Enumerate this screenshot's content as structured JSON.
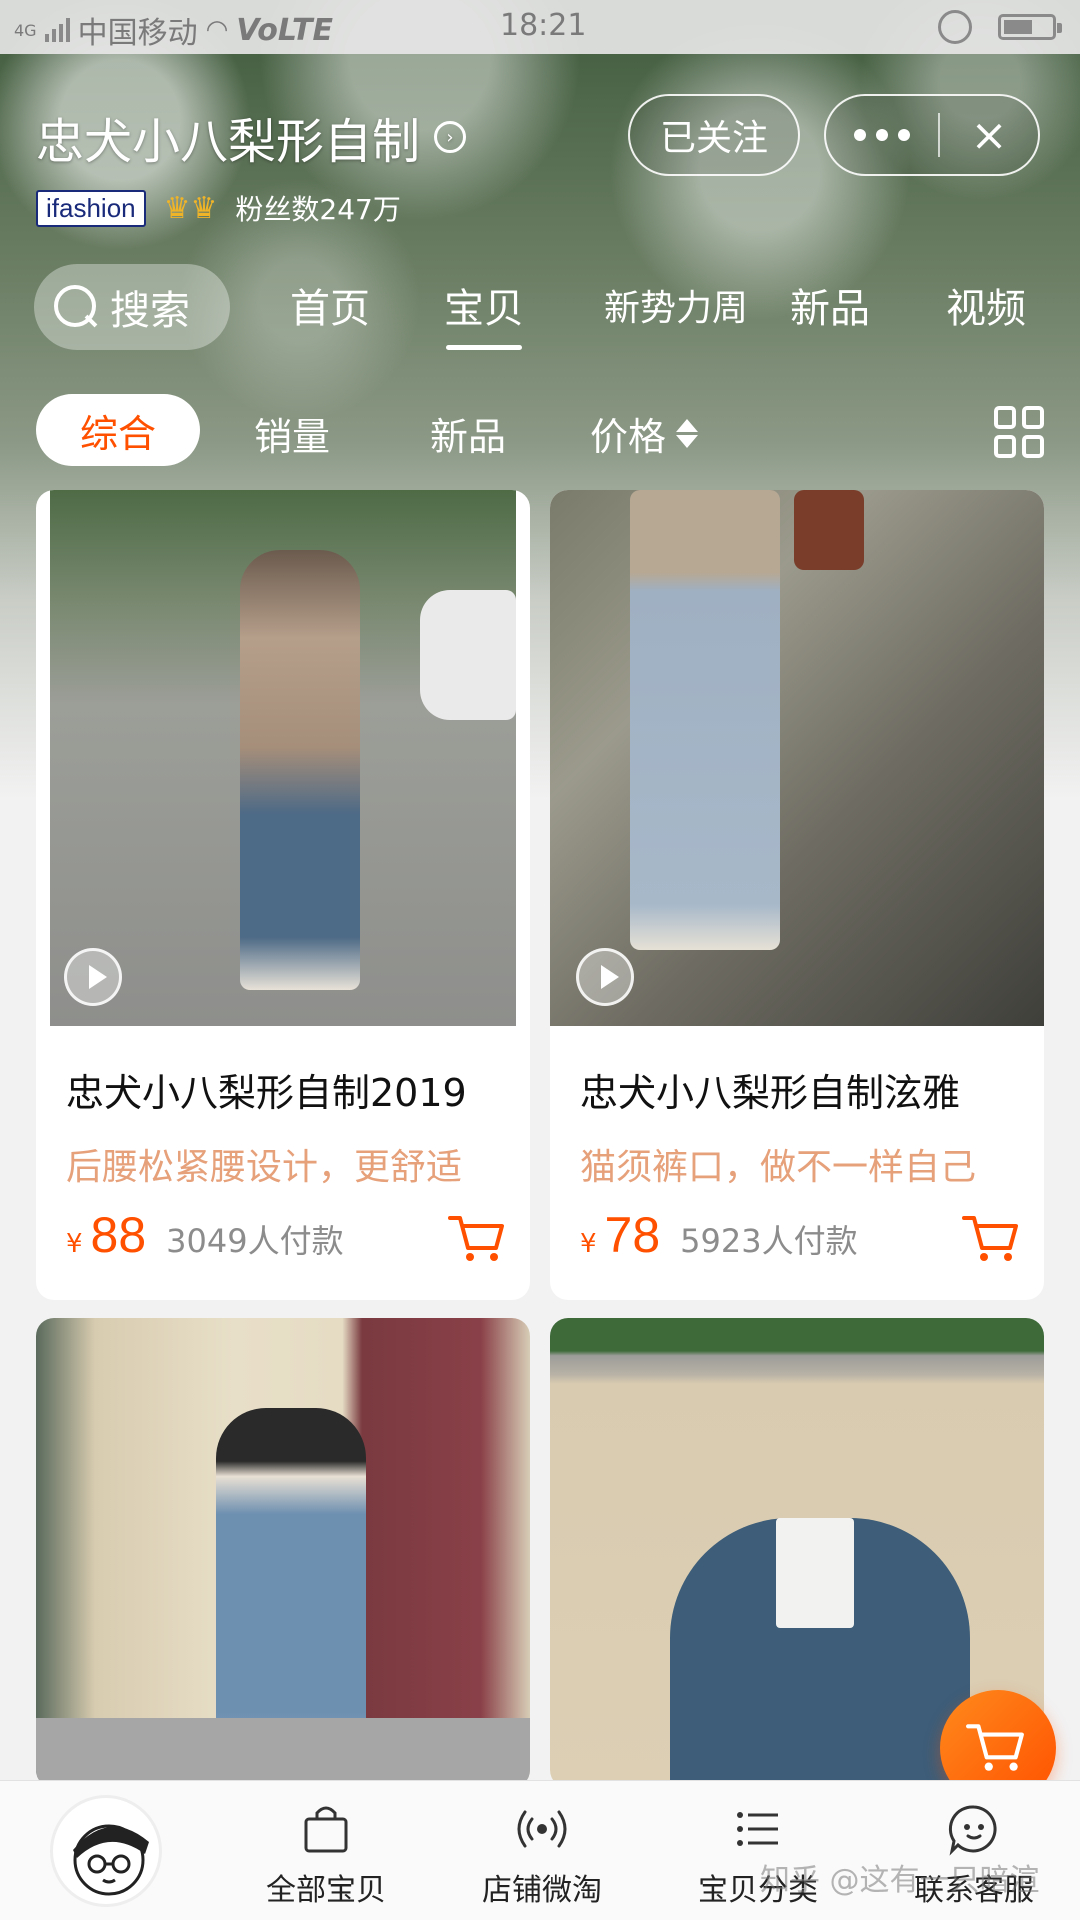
{
  "status_bar": {
    "carrier": "中国移动",
    "network": "4G",
    "volte": "VoLTE",
    "time": "18:21",
    "battery_level": 0.6
  },
  "header": {
    "shop_name": "忠犬小八梨形自制",
    "follow_button": "已关注",
    "badge": "ifashion",
    "fans": "粉丝数247万",
    "icons": [
      "chevron-right-circle-icon",
      "more-icon",
      "close-icon",
      "crown-icon"
    ]
  },
  "search": {
    "label": "搜索"
  },
  "tabs": [
    {
      "label": "首页",
      "active": false
    },
    {
      "label": "宝贝",
      "active": true
    },
    {
      "label": "新势力周",
      "active": false
    },
    {
      "label": "新品",
      "active": false
    },
    {
      "label": "视频",
      "active": false
    }
  ],
  "filters": [
    {
      "label": "综合",
      "active": true
    },
    {
      "label": "销量",
      "active": false
    },
    {
      "label": "新品",
      "active": false
    },
    {
      "label": "价格",
      "active": false
    }
  ],
  "products": [
    {
      "title": "忠犬小八梨形自制2019",
      "subtitle": "后腰松紧腰设计，更舒适",
      "currency": "¥",
      "price": "88",
      "sales": "3049人付款",
      "has_video": true
    },
    {
      "title": "忠犬小八梨形自制泫雅",
      "subtitle": "猫须裤口，做不一样自己",
      "currency": "¥",
      "price": "78",
      "sales": "5923人付款",
      "has_video": true
    },
    {
      "title": "",
      "subtitle": "",
      "currency": "",
      "price": "",
      "sales": "",
      "has_video": false
    },
    {
      "title": "",
      "subtitle": "",
      "currency": "",
      "price": "",
      "sales": "",
      "has_video": false
    }
  ],
  "bottom_nav": [
    {
      "label": "全部宝贝",
      "icon": "shopping-bag-icon"
    },
    {
      "label": "店铺微淘",
      "icon": "broadcast-icon"
    },
    {
      "label": "宝贝分类",
      "icon": "list-icon"
    },
    {
      "label": "联系客服",
      "icon": "chat-icon"
    }
  ],
  "watermark": "知乎 @这有一只暗渲",
  "colors": {
    "accent": "#ff5000",
    "subtitle": "#e6a07a",
    "muted": "#8c8c8c"
  }
}
